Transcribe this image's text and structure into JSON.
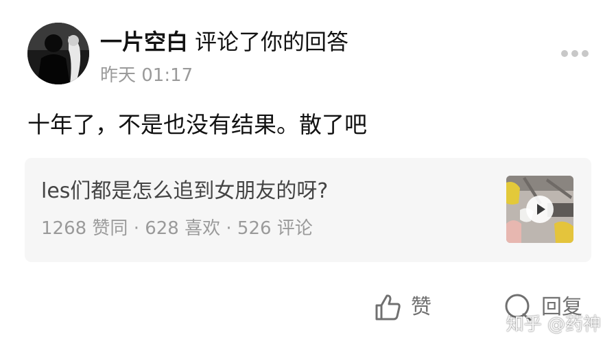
{
  "notification": {
    "user_name": "一片空白",
    "action_text": "评论了你的回答",
    "timestamp": "昨天 01:17",
    "comment": "十年了，不是也没有结果。散了吧"
  },
  "answer": {
    "title": "les们都是怎么追到女朋友的呀?",
    "stats": "1268 赞同 · 628 喜欢 · 526 评论"
  },
  "actions": {
    "like_label": "赞",
    "reply_label": "回复"
  },
  "watermark": "知乎 @药神",
  "icons": {
    "avatar": "user-avatar",
    "more": "more-dots-icon",
    "play": "play-icon",
    "like": "thumbs-up-icon",
    "reply": "comment-bubble-icon"
  },
  "colors": {
    "primary_text": "#121212",
    "secondary_text": "#9a9a9a",
    "card_bg": "#f6f6f6",
    "action_gray": "#707070"
  }
}
